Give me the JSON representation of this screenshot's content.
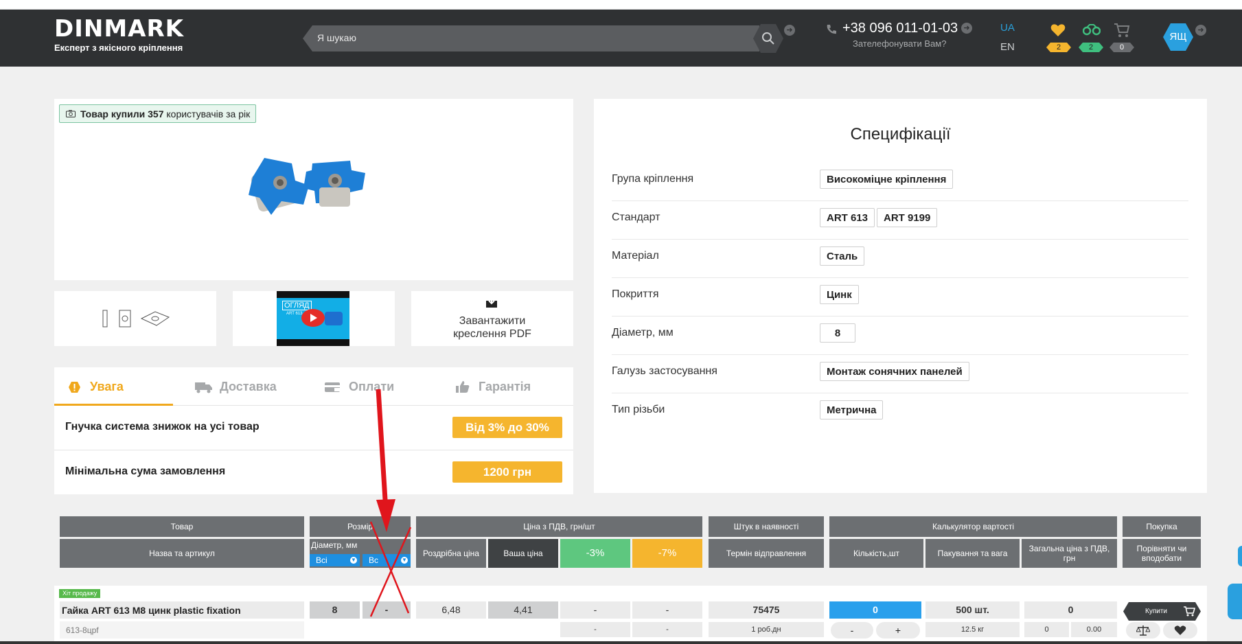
{
  "header": {
    "logo": "DINMARK",
    "tagline": "Експерт з якісного кріплення",
    "search_placeholder": "Я шукаю",
    "phone": "+38 096 011-01-03",
    "callback": "Зателефонувати Вам?",
    "lang_active": "UA",
    "lang_other": "EN",
    "favorites_count": "2",
    "compare_count": "2",
    "cart_count": "0",
    "user_initials": "ЯЩ",
    "accent_color": "#2aa0df"
  },
  "product_card": {
    "buyers_badge_bold": "Товар купили 357",
    "buyers_badge_rest": "користувачів за рік",
    "video_caption": "ОГЛЯД",
    "video_sub": "ART 613",
    "download_label_1": "Завантажити",
    "download_label_2": "креслення PDF"
  },
  "info_tabs": {
    "tabs": [
      "Увага",
      "Доставка",
      "Оплати",
      "Гарантія"
    ],
    "rows": [
      {
        "label": "Гнучка система знижок на усі товар",
        "value": "Від 3% до 30%"
      },
      {
        "label": "Мінімальна сума замовлення",
        "value": "1200 грн"
      }
    ]
  },
  "specs": {
    "title": "Специфікації",
    "rows": [
      {
        "label": "Група кріплення",
        "values": [
          "Високоміцне кріплення"
        ]
      },
      {
        "label": "Стандарт",
        "values": [
          "ART 613",
          "ART 9199"
        ]
      },
      {
        "label": "Матеріал",
        "values": [
          "Сталь"
        ]
      },
      {
        "label": "Покриття",
        "values": [
          "Цинк"
        ]
      },
      {
        "label": "Діаметр, мм",
        "values": [
          "8"
        ]
      },
      {
        "label": "Галузь застосування",
        "values": [
          "Монтаж сонячних панелей"
        ]
      },
      {
        "label": "Тип різьби",
        "values": [
          "Метрична"
        ]
      }
    ]
  },
  "table": {
    "headers": {
      "product": "Товар",
      "size": "Розмір",
      "price": "Ціна з ПДВ, грн/шт",
      "stock": "Штук в наявності",
      "calc": "Калькулятор вартості",
      "purchase": "Покупка"
    },
    "subheaders": {
      "name_article": "Назва та артикул",
      "diameter": "Діаметр, мм",
      "filter_all_1": "Всі",
      "filter_all_2": "Вс",
      "retail": "Роздрібна ціна",
      "your_price": "Ваша ціна",
      "disc3": "-3%",
      "disc7": "-7%",
      "ship_term": "Термін відправлення",
      "qty": "Кількість,шт",
      "pack": "Пакування та вага",
      "total": "Загальна ціна з ПДВ, грн",
      "compare": "Порівняти чи вподобати"
    },
    "row": {
      "hit_badge": "Хіт продажу",
      "name": "Гайка ART 613 M8 цинк plastic fixation",
      "code": "613-8цpf",
      "diameter": "8",
      "size2": "-",
      "retail": "6,48",
      "your_price": "4,41",
      "disc3": "-",
      "disc7": "-",
      "disc3_sub": "-",
      "disc7_sub": "-",
      "stock": "75475",
      "ship": "1 роб.дн",
      "qty": "0",
      "minus": "-",
      "plus": "+",
      "pack": "500 шт.",
      "weight": "12.5 кг",
      "total": "0",
      "total_sub_qty": "0",
      "total_sub_sum": "0.00",
      "buy": "Купити"
    }
  }
}
